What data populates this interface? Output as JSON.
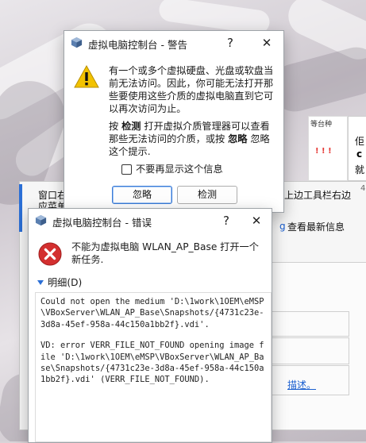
{
  "background": {
    "left_text_line1": "窗口右",
    "left_text_line2": "应菜单",
    "right_text1": "上边工具栏右边",
    "right_text2": "查看最新信息",
    "right_link": "g",
    "right_text3": "描述。",
    "thumb_text": "等台种",
    "thumb_exclaim": "! ! !",
    "right_edge_chars": [
      "佢",
      "c",
      "就"
    ],
    "right_edge_digit": "4"
  },
  "warning_dialog": {
    "title": "虚拟电脑控制台 - 警告",
    "help_label": "?",
    "close_label": "✕",
    "paragraph1": "有一个或多个虚拟硬盘、光盘或软盘当前无法访问。因此，你可能无法打开那些要使用这些介质的虚拟电脑直到它可以再次访问为止。",
    "paragraph2_prefix": "按",
    "paragraph2_check": "检测",
    "paragraph2_mid": "打开虚拟介质管理器可以查看那些无法访问的介质，或按",
    "paragraph2_ignore": "忽略",
    "paragraph2_suffix": "忽略这个提示.",
    "dont_show_label": "不要再显示这个信息",
    "dont_show_checked": false,
    "ignore_button": "忽略",
    "check_button": "检测"
  },
  "error_dialog": {
    "title": "虚拟电脑控制台 - 错误",
    "help_label": "?",
    "close_label": "✕",
    "message": "不能为虚拟电脑 WLAN_AP_Base 打开一个新任务.",
    "details_label": "明细(D)",
    "details": [
      "Could not open the medium 'D:\\1work\\1OEM\\eMSP\\VBoxServer\\WLAN_AP_Base\\Snapshots/{4731c23e-3d8a-45ef-958a-44c150a1bb2f}.vdi'.",
      "VD: error VERR_FILE_NOT_FOUND opening image file 'D:\\1work\\1OEM\\eMSP\\VBoxServer\\WLAN_AP_Base\\Snapshots/{4731c23e-3d8a-45ef-958a-44c150a1bb2f}.vdi' (VERR_FILE_NOT_FOUND)."
    ]
  },
  "colors": {
    "warning_yellow": "#f2c200",
    "error_red": "#d32f2f",
    "link_blue": "#1a5fd0",
    "thumb_red": "#e53935"
  }
}
